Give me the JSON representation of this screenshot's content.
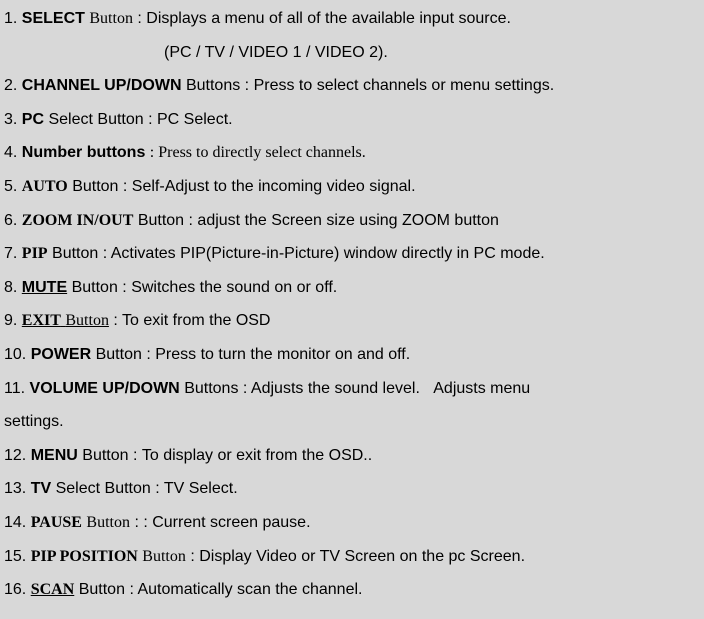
{
  "items": [
    {
      "num": "1.",
      "name": "SELECT",
      "nameClass": "bold sans",
      "label": "Button",
      "labelClass": "serif",
      "desc": ": Displays a menu of all of the available input source."
    },
    {
      "indent": true,
      "text": "(PC / TV / VIDEO 1 / VIDEO 2)."
    },
    {
      "num": "2.",
      "name": "CHANNEL UP/DOWN",
      "nameClass": "bold sans",
      "label": "Buttons",
      "labelClass": "",
      "desc": ": Press to select channels or menu settings."
    },
    {
      "num": "3.",
      "name": "PC",
      "nameClass": "bold",
      "label": "Select Button",
      "labelClass": "",
      "desc": ": PC Select."
    },
    {
      "num": "4.",
      "name": "Number buttons",
      "nameClass": "bold sans",
      "label": "",
      "labelClass": "",
      "desc": ": Press to directly select channels.",
      "descClass": "serif"
    },
    {
      "num": "5.",
      "name": "AUTO",
      "nameClass": "bold serif",
      "label": "Button",
      "labelClass": "",
      "desc": ": Self-Adjust to the incoming video signal."
    },
    {
      "num": "6.",
      "name": "ZOOM IN/OUT",
      "nameClass": "bold serif",
      "label": "Button",
      "labelClass": "",
      "desc": ": adjust the Screen size using ZOOM button"
    },
    {
      "num": "7.",
      "name": "PIP",
      "nameClass": "bold serif",
      "label": "Button",
      "labelClass": "",
      "desc": ": Activates PIP(Picture-in-Picture) window directly in PC mode."
    },
    {
      "num": "8.",
      "name": "MUTE",
      "nameClass": "bold",
      "underline": true,
      "label": "Button",
      "labelClass": "",
      "desc": ": Switches the sound on or off."
    },
    {
      "num": "9.",
      "name": "EXIT",
      "nameClass": "bold serif",
      "underline": true,
      "label": "Button",
      "labelClass": "serif",
      "underlineLabel": true,
      "desc": ": To exit from the OSD"
    },
    {
      "num": "10.",
      "name": "POWER",
      "nameClass": "bold",
      "label": "Button",
      "labelClass": "",
      "desc": ": ",
      "descExtra": "Press to turn the monitor on and off.",
      "descExtraClass": "trebuchet"
    },
    {
      "num": "11.",
      "name": "VOLUME UP/DOWN",
      "nameClass": "bold sans",
      "label": "Buttons",
      "labelClass": "",
      "desc": ": Adjusts the sound level.   Adjusts menu"
    },
    {
      "continuation": true,
      "text": "settings."
    },
    {
      "num": "12.",
      "name": "MENU",
      "nameClass": "bold sans",
      "label": "Button",
      "labelClass": "",
      "desc": ": ",
      "descExtra": "To display or exit from the OSD.",
      "descExtraClass": "trebuchet",
      "descSuffix": "."
    },
    {
      "num": "13.",
      "name": "TV",
      "nameClass": "bold",
      "label": "Select Button",
      "labelClass": "",
      "desc": ": TV Select."
    },
    {
      "num": "14.",
      "name": "PAUSE",
      "nameClass": "bold serif",
      "label": "Button",
      "labelClass": "serif",
      "desc": ": : Current screen pause."
    },
    {
      "num": "15.",
      "name": "PIP POSITION",
      "nameClass": "bold serif",
      "label": "Button",
      "labelClass": "serif",
      "desc": ": Display Video or TV Screen on the pc Screen."
    },
    {
      "num": "16.",
      "name": "SCAN",
      "nameClass": "bold serif",
      "underline": true,
      "label": "Button",
      "labelClass": "",
      "desc": ": Automatically scan the channel."
    }
  ]
}
